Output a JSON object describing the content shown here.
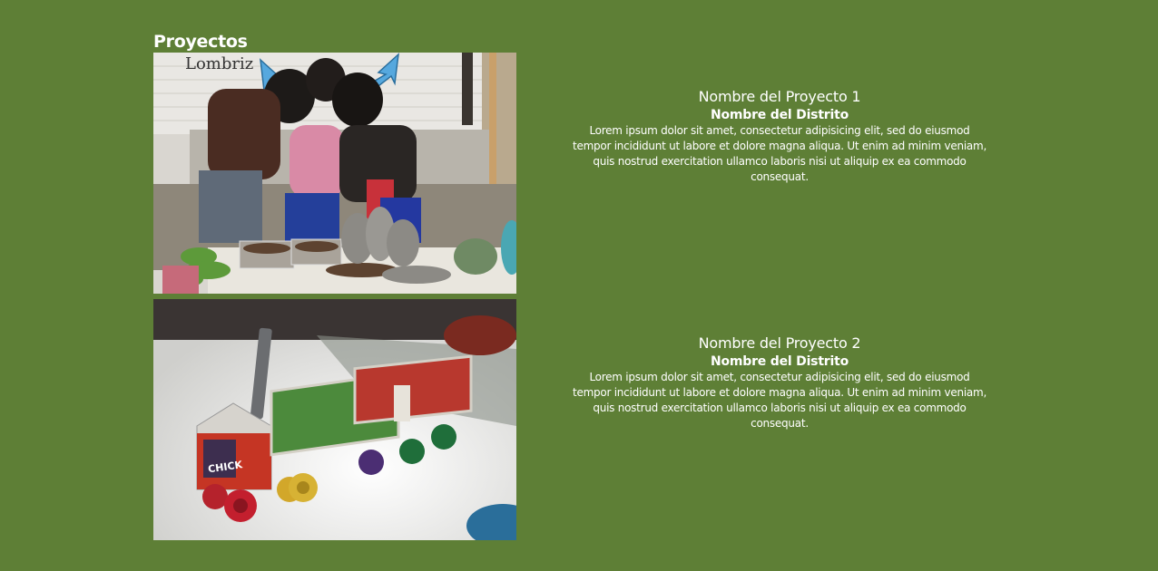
{
  "section": {
    "title": "Proyectos"
  },
  "projects": [
    {
      "name": "Nombre del Proyecto 1",
      "district": "Nombre del Distrito",
      "description": "Lorem ipsum dolor sit amet, consectetur adipisicing elit, sed do eiusmod tempor incididunt ut labore et dolore magna aliqua. Ut enim ad minim veniam, quis nostrud exercitation ullamco laboris nisi ut aliquip ex ea commodo consequat.",
      "photo_wall_text": "Lombriz"
    },
    {
      "name": "Nombre del Proyecto 2",
      "district": "Nombre del Distrito",
      "description": "Lorem ipsum dolor sit amet, consectetur adipisicing elit, sed do eiusmod tempor incididunt ut labore et dolore magna aliqua. Ut enim ad minim veniam, quis nostrud exercitation ullamco laboris nisi ut aliquip ex ea commodo consequat.",
      "photo_box_text": "CHICK"
    }
  ],
  "colors": {
    "background": "#5e7f36",
    "text": "#ffffff"
  }
}
